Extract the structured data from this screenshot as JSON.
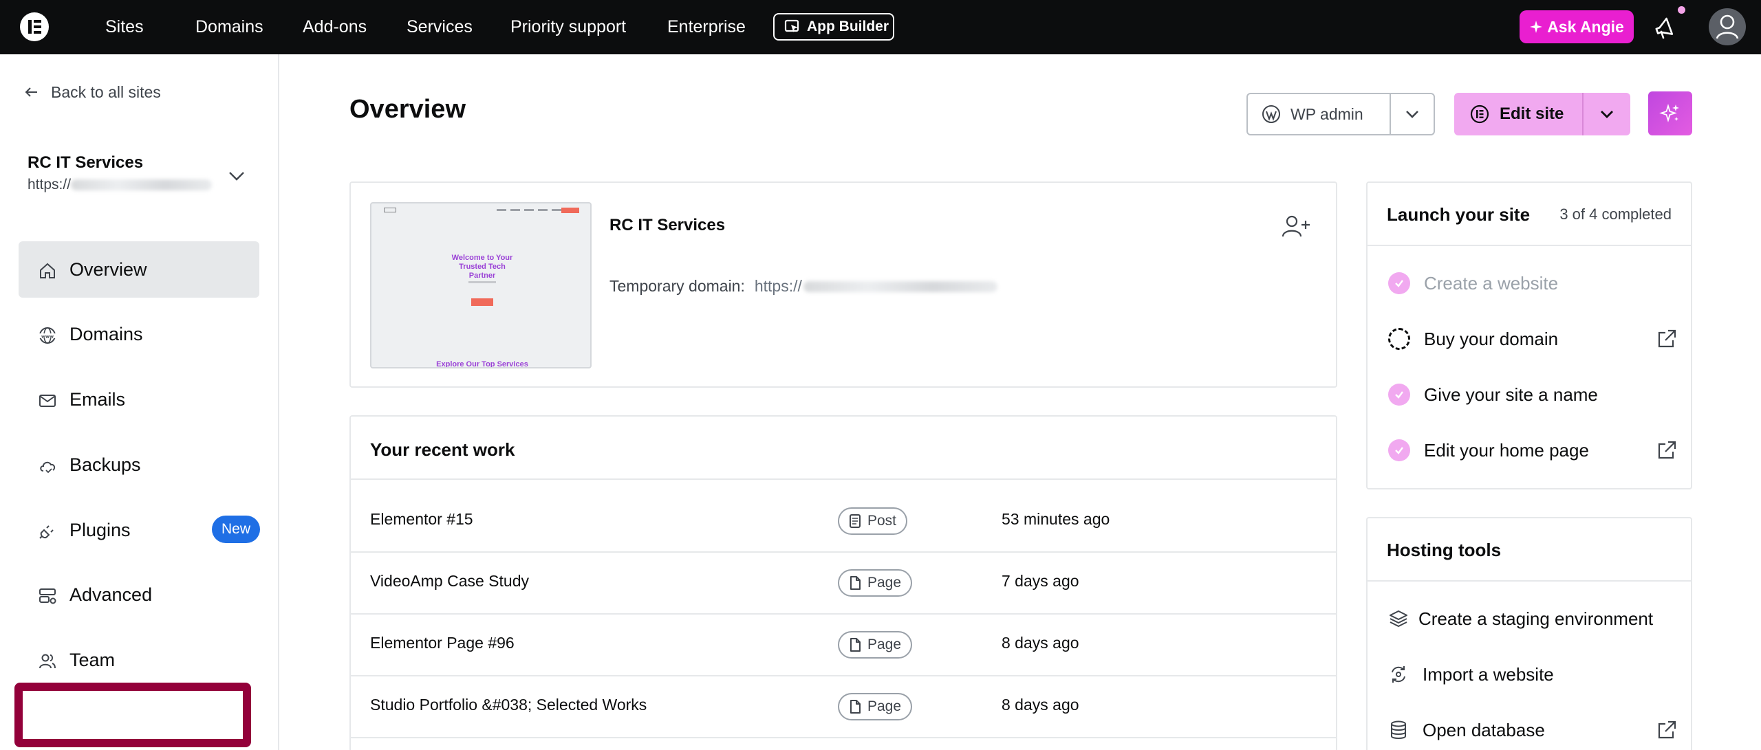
{
  "topbar": {
    "nav": [
      "Sites",
      "Domains",
      "Add-ons",
      "Services",
      "Priority support",
      "Enterprise"
    ],
    "app_builder": "App Builder",
    "ask_angie": "Ask Angie"
  },
  "sidebar": {
    "back": "Back to all sites",
    "site_name": "RC IT Services",
    "site_url_prefix": "https://",
    "items": [
      {
        "label": "Overview",
        "icon": "home-icon"
      },
      {
        "label": "Domains",
        "icon": "globe-icon"
      },
      {
        "label": "Emails",
        "icon": "mail-icon"
      },
      {
        "label": "Backups",
        "icon": "cloud-icon"
      },
      {
        "label": "Plugins",
        "icon": "plug-icon",
        "badge": "New"
      },
      {
        "label": "Advanced",
        "icon": "settings-panel-icon"
      },
      {
        "label": "Team",
        "icon": "users-icon"
      }
    ]
  },
  "main": {
    "title": "Overview",
    "wp_admin": "WP admin",
    "edit_site": "Edit site",
    "site_card": {
      "name": "RC IT Services",
      "temp_domain_label": "Temporary domain:",
      "temp_domain_prefix": "https://",
      "thumbnail": {
        "headline_1": "Welcome to Your",
        "headline_2": "Trusted Tech",
        "headline_3": "Partner",
        "footer": "Explore Our Top Services"
      }
    },
    "recent_work": {
      "heading": "Your recent work",
      "rows": [
        {
          "title": "Elementor #15",
          "type": "Post",
          "time": "53 minutes ago"
        },
        {
          "title": "VideoAmp Case Study",
          "type": "Page",
          "time": "7 days ago"
        },
        {
          "title": "Elementor Page #96",
          "type": "Page",
          "time": "8 days ago"
        },
        {
          "title": "Studio Portfolio &#038; Selected Works",
          "type": "Page",
          "time": "8 days ago"
        }
      ]
    },
    "launch": {
      "title": "Launch your site",
      "count": "3 of 4 completed",
      "steps": [
        {
          "label": "Create a website",
          "done": true
        },
        {
          "label": "Buy your domain",
          "done": false
        },
        {
          "label": "Give your site a name",
          "done": true
        },
        {
          "label": "Edit your home page",
          "done": true
        }
      ]
    },
    "hosting": {
      "title": "Hosting tools",
      "tools": [
        {
          "label": "Create a staging environment",
          "icon": "layers-icon"
        },
        {
          "label": "Import a website",
          "icon": "import-icon"
        },
        {
          "label": "Open database",
          "icon": "database-icon"
        }
      ]
    }
  },
  "colors": {
    "topbar_bg": "#0c0d0e",
    "angie_pink": "#e91fd0",
    "edit_pink": "#f1a9f0",
    "badge_blue": "#1f6fe5",
    "highlight": "#93003a"
  }
}
